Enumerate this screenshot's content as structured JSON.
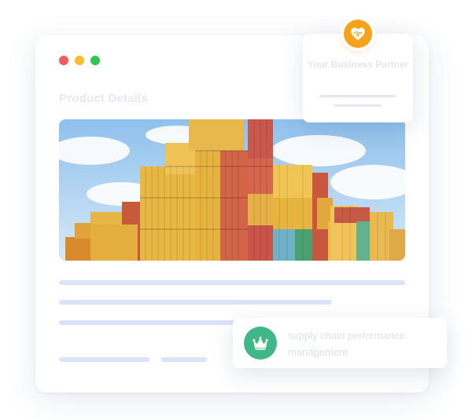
{
  "window": {
    "title": "Product Details",
    "traffic_lights": [
      "red",
      "yellow",
      "green"
    ]
  },
  "partner_card": {
    "icon": "handshake-heart-icon",
    "label": "Your Business Partner"
  },
  "scm_card": {
    "icon": "crown-icon",
    "label": "supply chain performance management"
  },
  "colors": {
    "accent_orange": "#f6a21a",
    "accent_green": "#3fb789",
    "placeholder_bar": "#d9e4fb"
  }
}
